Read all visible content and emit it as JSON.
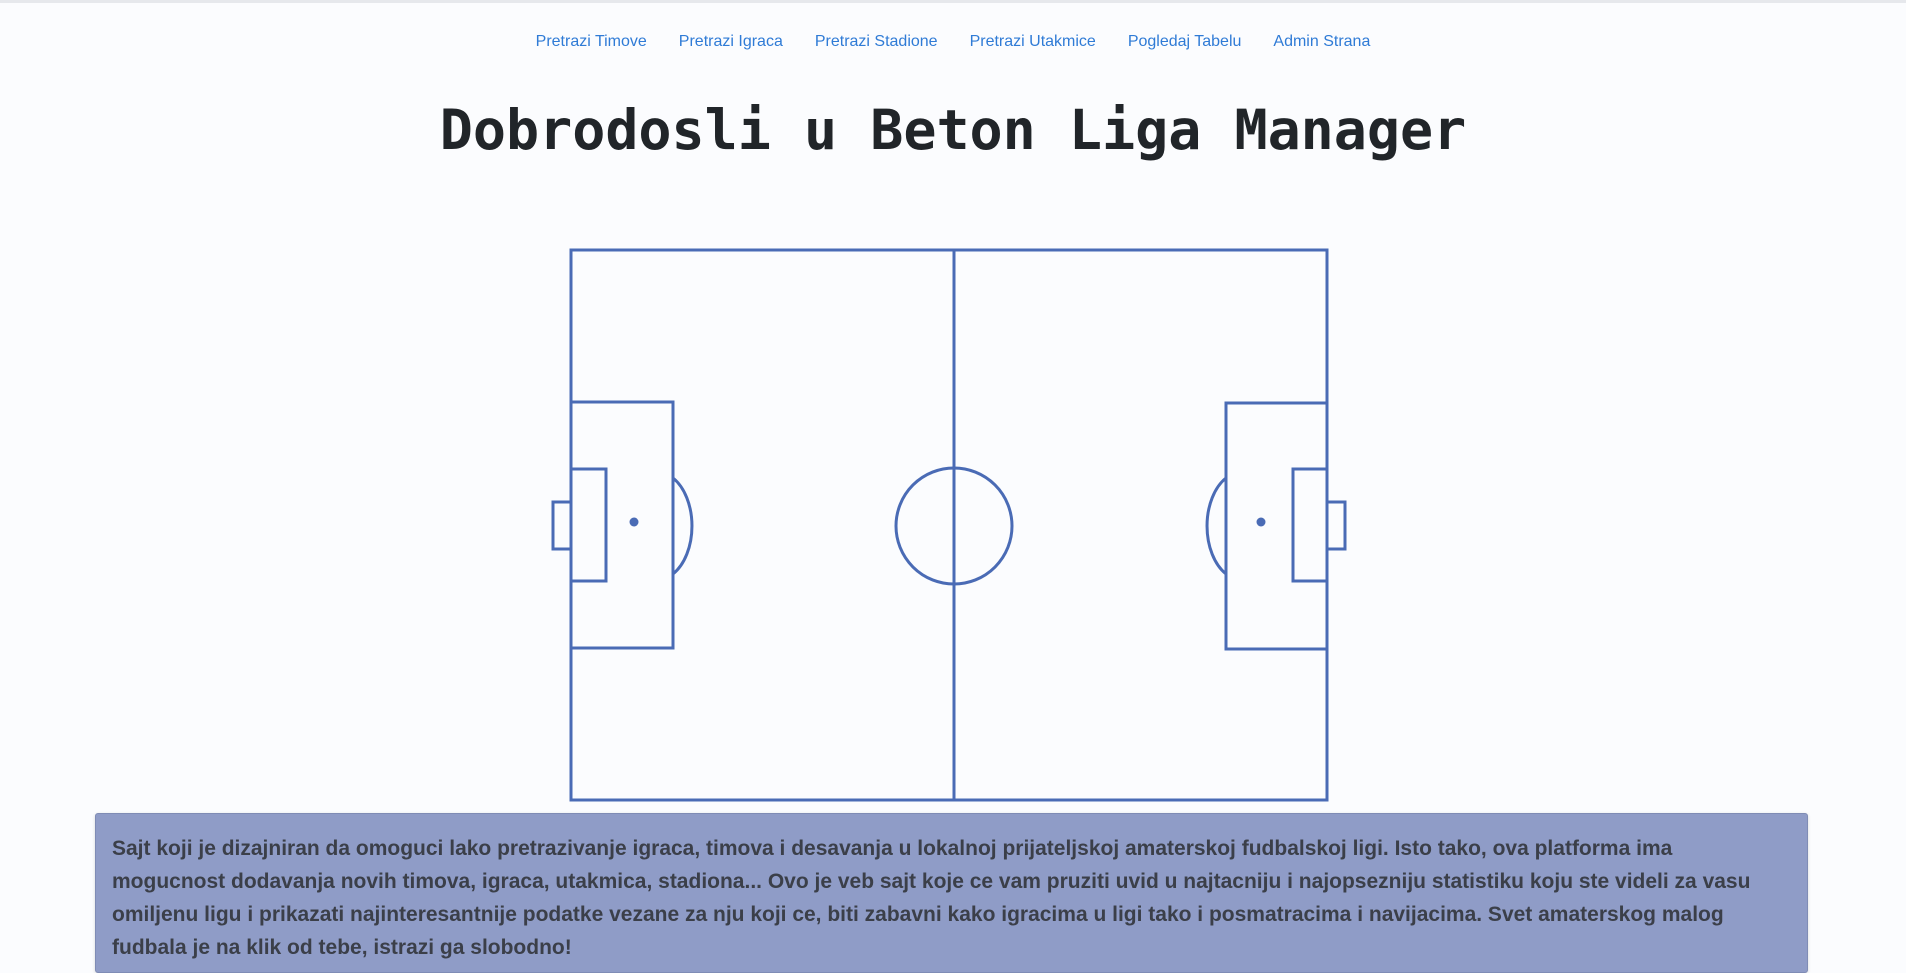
{
  "nav": {
    "items": [
      {
        "label": "Pretrazi Timove"
      },
      {
        "label": "Pretrazi Igraca"
      },
      {
        "label": "Pretrazi Stadione"
      },
      {
        "label": "Pretrazi Utakmice"
      },
      {
        "label": "Pogledaj Tabelu"
      },
      {
        "label": "Admin Strana"
      }
    ]
  },
  "main": {
    "title": "Dobrodosli u Beton Liga Manager",
    "description": "Sajt koji je dizajniran da omoguci lako pretrazivanje igraca, timova i desavanja u lokalnoj prijateljskoj amaterskoj fudbalskoj ligi. Isto tako, ova platforma ima mogucnost dodavanja novih timova, igraca, utakmica, stadiona... Ovo je veb sajt koje ce vam pruziti uvid u najtacniju i najopsezniju statistiku koju ste videli za vasu omiljenu ligu i prikazati najinteresantnije podatke vezane za nju koji ce, biti zabavni kako igracima u ligi tako i posmatracima i navijacima. Svet amaterskog malog fudbala je na klik od tebe, istrazi ga slobodno!"
  },
  "colors": {
    "nav_link": "#2f7bd6",
    "pitch_lines": "#4a6bb5",
    "description_bg": "#8f9cc7",
    "page_bg": "#fbfcfe"
  }
}
